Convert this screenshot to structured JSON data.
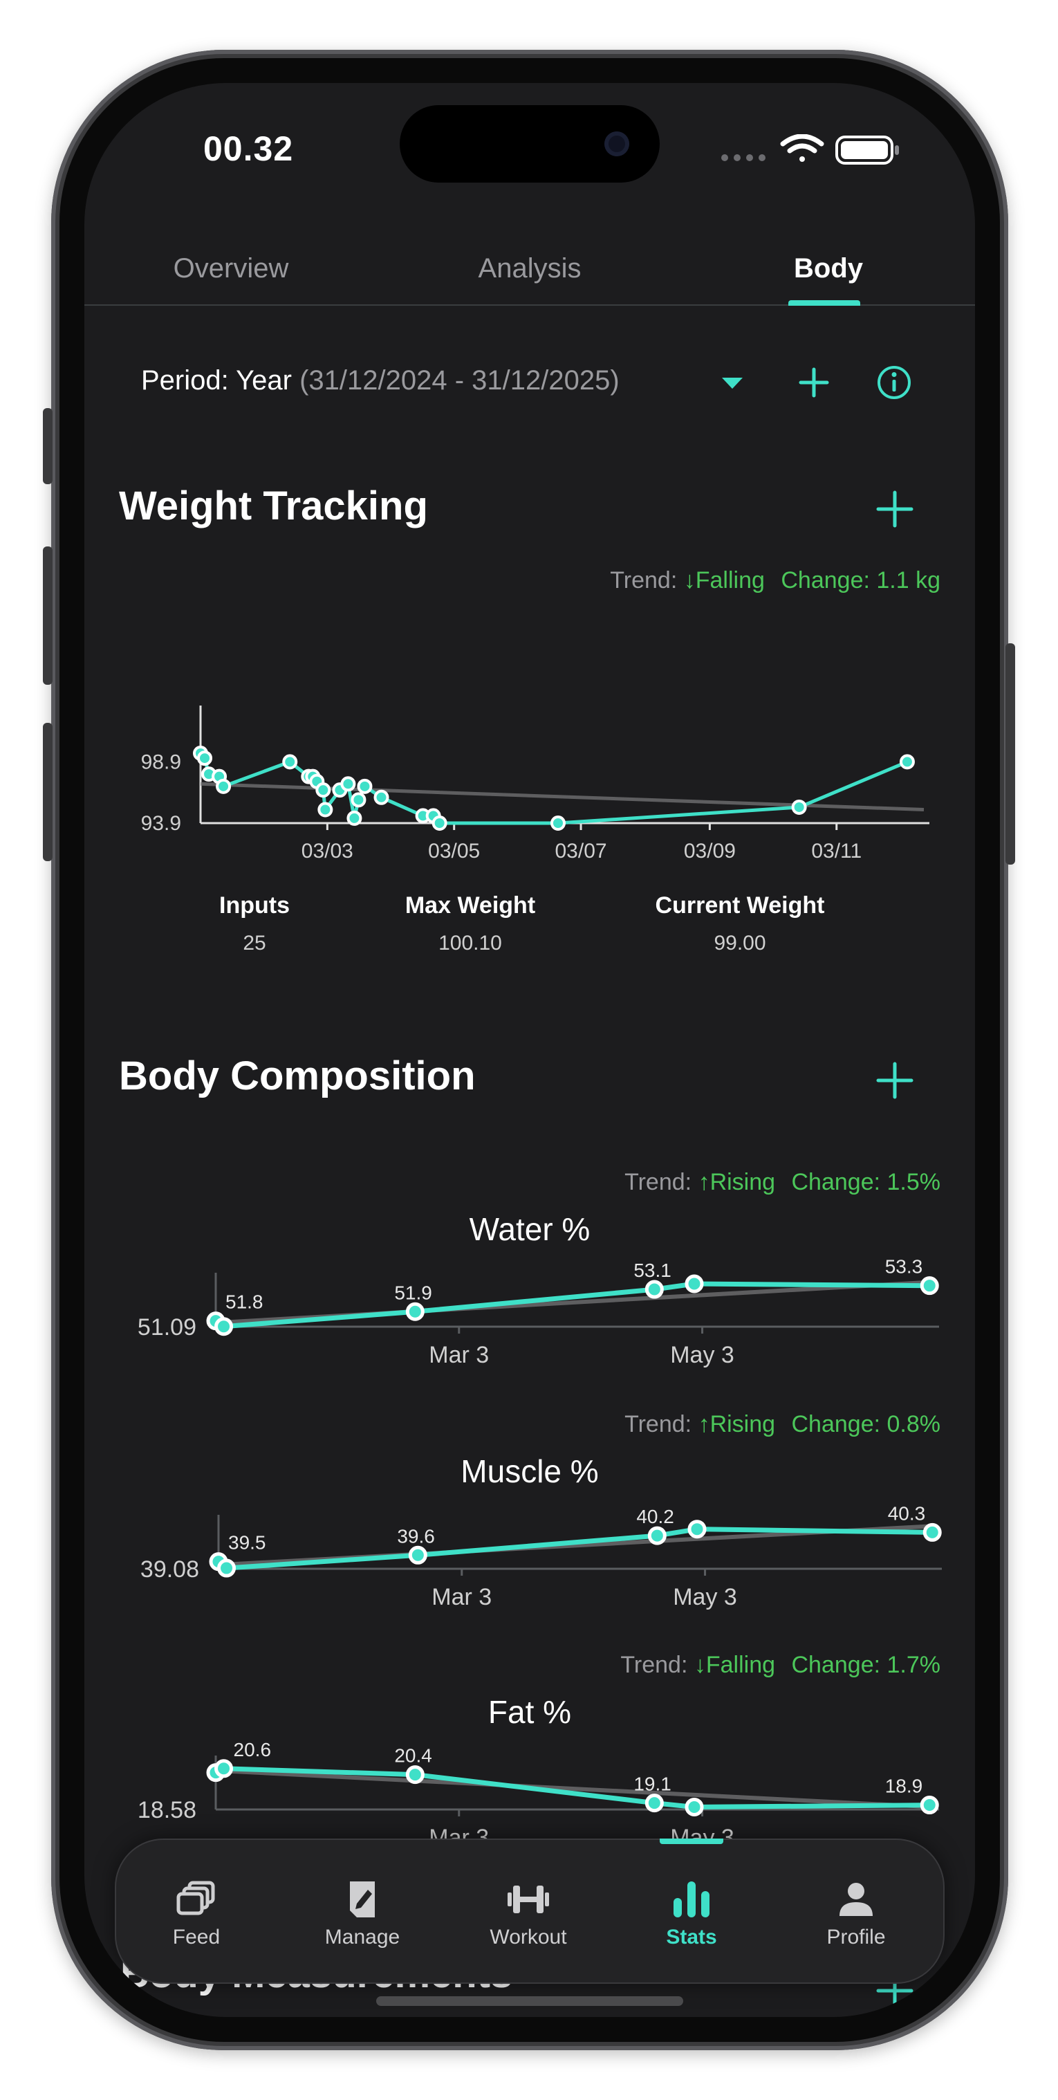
{
  "status_bar": {
    "time": "00.32"
  },
  "tabs": [
    {
      "label": "Overview",
      "active": false
    },
    {
      "label": "Analysis",
      "active": false
    },
    {
      "label": "Body",
      "active": true
    }
  ],
  "period": {
    "label": "Period: Year",
    "range": "(31/12/2024 - 31/12/2025)"
  },
  "colors": {
    "accent": "#3fe0c8",
    "trend_text": "#4cc75a",
    "background": "#1c1c1e"
  },
  "weight": {
    "title": "Weight Tracking",
    "trend_label": "Trend:",
    "trend_value": "↓Falling",
    "change": "Change: 1.1 kg",
    "stats": [
      {
        "label": "Inputs",
        "value": "25"
      },
      {
        "label": "Max Weight",
        "value": "100.10"
      },
      {
        "label": "Current Weight",
        "value": "99.00"
      }
    ]
  },
  "body_composition": {
    "title": "Body Composition",
    "charts": [
      {
        "title": "Water %",
        "trend_label": "Trend:",
        "trend_value": "↑Rising",
        "change": "Change: 1.5%"
      },
      {
        "title": "Muscle %",
        "trend_label": "Trend:",
        "trend_value": "↑Rising",
        "change": "Change: 0.8%"
      },
      {
        "title": "Fat %",
        "trend_label": "Trend:",
        "trend_value": "↓Falling",
        "change": "Change: 1.7%"
      }
    ]
  },
  "body_measurements": {
    "title": "Body Measurements"
  },
  "chart_data": [
    {
      "type": "line",
      "name": "weight",
      "title": "",
      "y_ticks": [
        "98.9",
        "93.9"
      ],
      "y_tick_values": [
        98.9,
        93.9
      ],
      "ylim": [
        93.9,
        101.8
      ],
      "x_ticks": [
        "03/03",
        "03/05",
        "03/07",
        "03/09",
        "03/11"
      ],
      "x_tick_values": [
        "2025-03-03",
        "2025-05-03",
        "2025-07-03",
        "2025-09-03",
        "2025-11-03"
      ],
      "xlim": [
        "2025-01-01",
        "2025-12-15"
      ],
      "x": [
        "2025-01-01",
        "2025-01-03",
        "2025-01-05",
        "2025-01-10",
        "2025-01-12",
        "2025-02-13",
        "2025-02-22",
        "2025-02-24",
        "2025-02-26",
        "2025-03-01",
        "2025-03-02",
        "2025-03-09",
        "2025-03-13",
        "2025-03-16",
        "2025-03-18",
        "2025-03-21",
        "2025-03-29",
        "2025-04-18",
        "2025-04-23",
        "2025-04-26",
        "2025-06-22",
        "2025-10-16",
        "2025-12-07"
      ],
      "y": [
        99.6,
        99.2,
        97.9,
        97.7,
        96.9,
        98.9,
        97.7,
        97.7,
        97.3,
        96.6,
        95.0,
        96.6,
        97.1,
        94.3,
        95.8,
        96.9,
        96.0,
        94.5,
        94.5,
        93.9,
        93.9,
        95.2,
        98.9
      ],
      "trend_line": {
        "y_start": 97.1,
        "y_end": 95.0
      },
      "grid": false,
      "legend": "none"
    },
    {
      "type": "line",
      "name": "water",
      "title": "Water %",
      "y_tick": "51.09",
      "ylim": [
        51.09,
        53.4
      ],
      "x_ticks": [
        "Mar 3",
        "May 3"
      ],
      "x_tick_values": [
        "2025-03-03",
        "2025-05-03"
      ],
      "xlim": [
        "2025-01-01",
        "2025-06-30"
      ],
      "x": [
        "2025-01-01",
        "2025-01-03",
        "2025-02-20",
        "2025-04-21",
        "2025-05-01",
        "2025-06-29"
      ],
      "y": [
        51.4,
        51.1,
        51.9,
        53.1,
        53.4,
        53.3
      ],
      "labels": [
        "51.8",
        "",
        "51.9",
        "53.1",
        "",
        "53.3"
      ],
      "trend_line": {
        "y_start": 51.3,
        "y_end": 53.5
      },
      "grid": false,
      "legend": "none"
    },
    {
      "type": "line",
      "name": "muscle",
      "title": "Muscle %",
      "y_tick": "39.08",
      "ylim": [
        39.08,
        40.4
      ],
      "x_ticks": [
        "Mar 3",
        "May 3"
      ],
      "x_tick_values": [
        "2025-03-03",
        "2025-05-03"
      ],
      "xlim": [
        "2025-01-01",
        "2025-06-30"
      ],
      "x": [
        "2025-01-01",
        "2025-01-03",
        "2025-02-20",
        "2025-04-21",
        "2025-05-01",
        "2025-06-29"
      ],
      "y": [
        39.3,
        39.1,
        39.5,
        40.1,
        40.3,
        40.2
      ],
      "labels": [
        "39.5",
        "",
        "39.6",
        "40.2",
        "",
        "40.3"
      ],
      "trend_line": {
        "y_start": 39.2,
        "y_end": 40.4
      },
      "grid": false,
      "legend": "none"
    },
    {
      "type": "line",
      "name": "fat",
      "title": "Fat %",
      "y_tick": "18.58",
      "ylim": [
        18.58,
        20.9
      ],
      "x_ticks": [
        "Mar 3",
        "May 3"
      ],
      "x_tick_values": [
        "2025-03-03",
        "2025-05-03"
      ],
      "xlim": [
        "2025-01-01",
        "2025-06-30"
      ],
      "x": [
        "2025-01-01",
        "2025-01-03",
        "2025-02-20",
        "2025-04-21",
        "2025-05-01",
        "2025-06-29"
      ],
      "y": [
        20.4,
        20.6,
        20.3,
        18.9,
        18.7,
        18.8
      ],
      "labels": [
        "",
        "20.6",
        "20.4",
        "19.1",
        "",
        "18.9"
      ],
      "trend_line": {
        "y_start": 20.5,
        "y_end": 18.7
      },
      "grid": false,
      "legend": "none"
    }
  ],
  "nav": {
    "items": [
      {
        "label": "Feed",
        "icon": "feed-icon",
        "active": false
      },
      {
        "label": "Manage",
        "icon": "manage-icon",
        "active": false
      },
      {
        "label": "Workout",
        "icon": "dumbbell-icon",
        "active": false
      },
      {
        "label": "Stats",
        "icon": "stats-icon",
        "active": true
      },
      {
        "label": "Profile",
        "icon": "profile-icon",
        "active": false
      }
    ]
  }
}
